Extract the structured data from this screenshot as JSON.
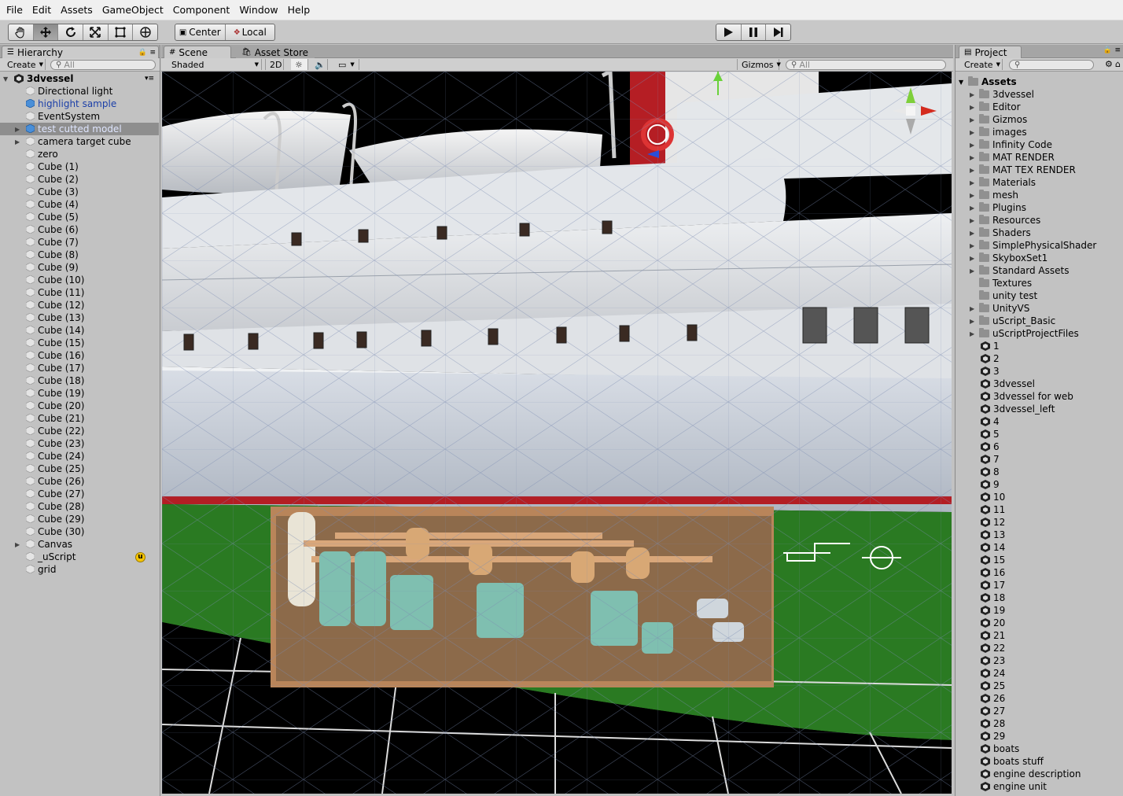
{
  "menu": [
    "File",
    "Edit",
    "Assets",
    "GameObject",
    "Component",
    "Window",
    "Help"
  ],
  "toolbar": {
    "center_label": "Center",
    "local_label": "Local"
  },
  "hierarchy": {
    "tab": "Hierarchy",
    "create": "Create",
    "search_placeholder": "All",
    "root": "3dvessel",
    "items": [
      "Directional light",
      "highlight sample",
      "EventSystem",
      "test cutted model",
      "camera target cube",
      "zero",
      "Cube (1)",
      "Cube (2)",
      "Cube (3)",
      "Cube (4)",
      "Cube (5)",
      "Cube (6)",
      "Cube (7)",
      "Cube (8)",
      "Cube (9)",
      "Cube (10)",
      "Cube (11)",
      "Cube (12)",
      "Cube (13)",
      "Cube (14)",
      "Cube (15)",
      "Cube (16)",
      "Cube (17)",
      "Cube (18)",
      "Cube (19)",
      "Cube (20)",
      "Cube (21)",
      "Cube (22)",
      "Cube (23)",
      "Cube (24)",
      "Cube (25)",
      "Cube (26)",
      "Cube (27)",
      "Cube (28)",
      "Cube (29)",
      "Cube (30)",
      "Canvas",
      "_uScript",
      "grid"
    ]
  },
  "scene": {
    "tab": "Scene",
    "tab2": "Asset Store",
    "shading": "Shaded",
    "mode_2d": "2D",
    "gizmos": "Gizmos",
    "search_placeholder": "All"
  },
  "project": {
    "tab": "Project",
    "create": "Create",
    "root": "Assets",
    "folders": [
      "3dvessel",
      "Editor",
      "Gizmos",
      "images",
      "Infinity Code",
      "MAT RENDER",
      "MAT TEX RENDER",
      "Materials",
      "mesh",
      "Plugins",
      "Resources",
      "Shaders",
      "SimplePhysicalShader",
      "SkyboxSet1",
      "Standard Assets",
      "Textures",
      "unity test",
      "UnityVS",
      "uScript_Basic",
      "uScriptProjectFiles"
    ],
    "scenes": [
      "1",
      "2",
      "3",
      "3dvessel",
      "3dvessel for web",
      "3dvessel_left",
      "4",
      "5",
      "6",
      "7",
      "8",
      "9",
      "10",
      "11",
      "12",
      "13",
      "14",
      "15",
      "16",
      "17",
      "18",
      "19",
      "20",
      "21",
      "22",
      "23",
      "24",
      "25",
      "26",
      "27",
      "28",
      "29",
      "boats",
      "boats stuff",
      "engine description",
      "engine unit"
    ]
  }
}
